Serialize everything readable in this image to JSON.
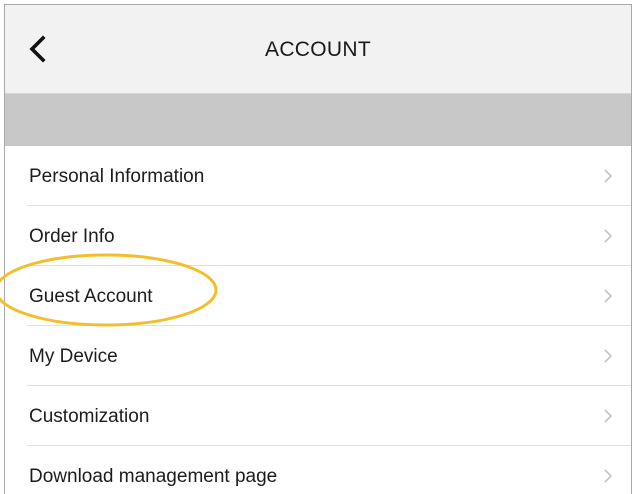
{
  "header": {
    "title": "ACCOUNT",
    "back_icon": "chevron-left-icon"
  },
  "menu": {
    "items": [
      {
        "label": "Personal Information"
      },
      {
        "label": "Order Info"
      },
      {
        "label": "Guest Account"
      },
      {
        "label": "My Device"
      },
      {
        "label": "Customization"
      },
      {
        "label": "Download management page"
      }
    ],
    "chevron_icon": "chevron-right-icon"
  },
  "annotation": {
    "highlight_target": "Guest Account",
    "highlight_color": "#f3be2b"
  },
  "colors": {
    "header_bg": "#f2f2f2",
    "band_bg": "#c8c8c8",
    "divider": "#e0e0e0",
    "chevron": "#c4c4c4"
  }
}
